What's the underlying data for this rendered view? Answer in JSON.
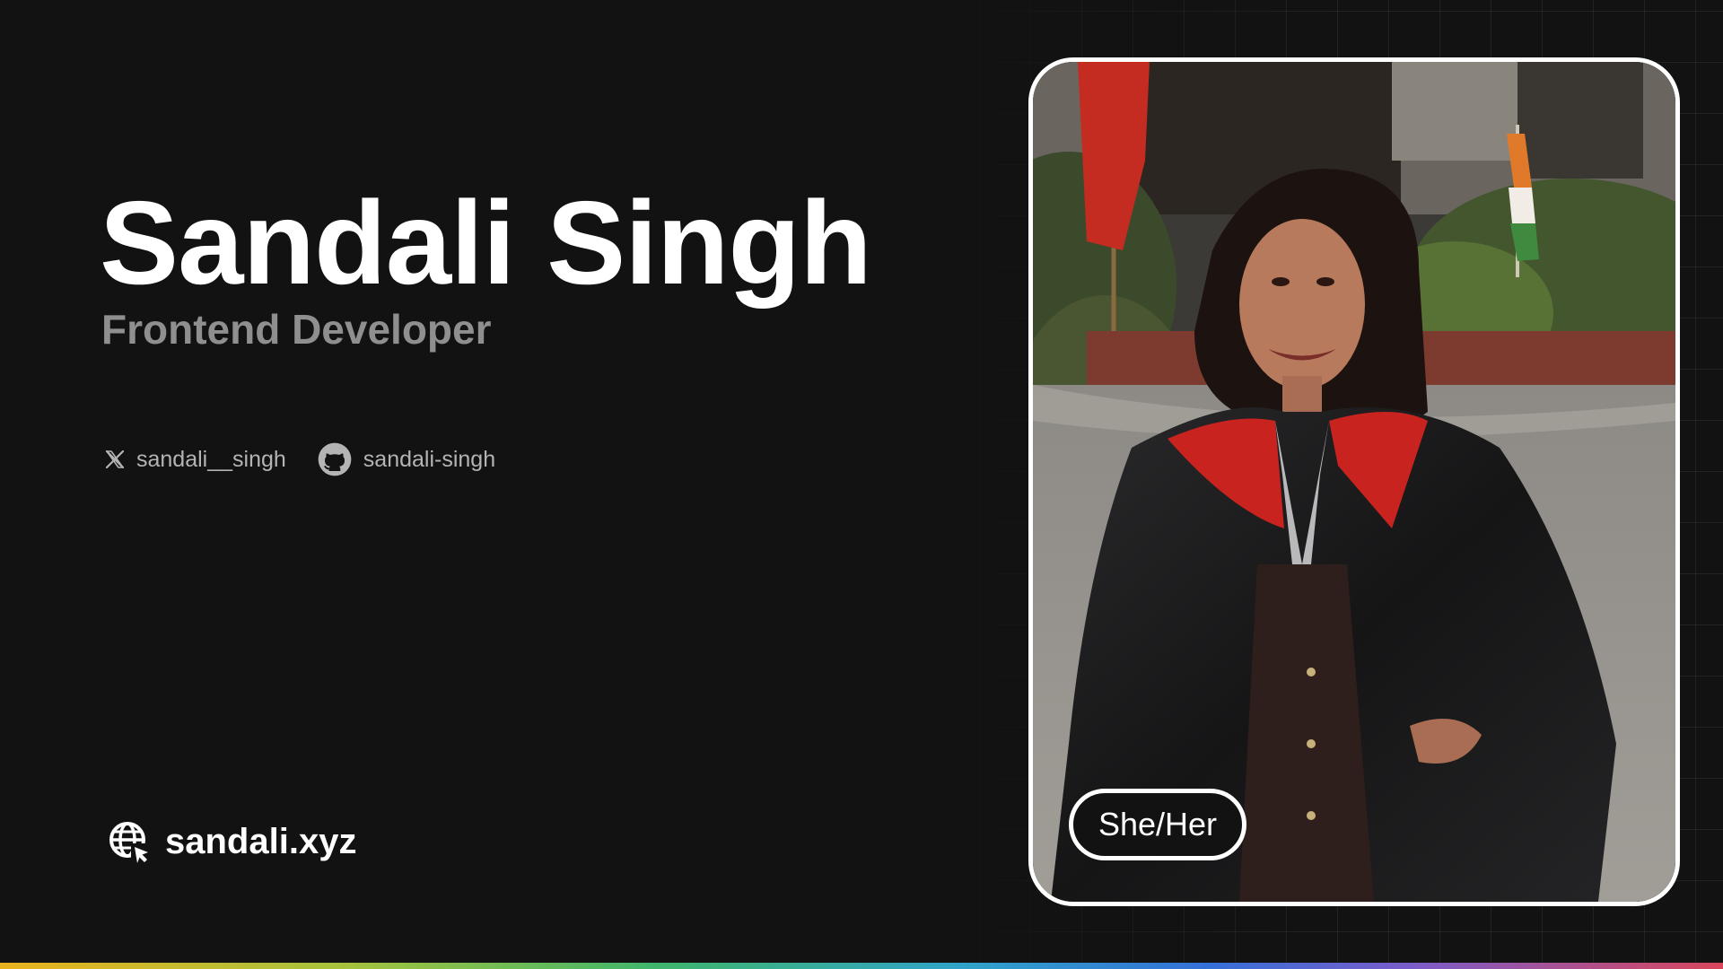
{
  "profile": {
    "name": "Sandali Singh",
    "role": "Frontend Developer",
    "pronouns": "She/Her"
  },
  "socials": [
    {
      "icon": "x-logo-icon",
      "handle": "sandali__singh"
    },
    {
      "icon": "github-icon",
      "handle": "sandali-singh"
    }
  ],
  "website": {
    "icon": "globe-cursor-icon",
    "label": "sandali.xyz"
  },
  "photo": {
    "description_icon": "profile-photo"
  },
  "colors": {
    "background": "#121212",
    "name": "#ffffff",
    "role": "#8f8f8f",
    "social_text": "#b4b4b4",
    "card_border": "#ffffff",
    "rainbow": [
      "#e8b21f",
      "#a6c23c",
      "#3fb56b",
      "#2fa3c9",
      "#3470d8",
      "#7b5cc9",
      "#d9465b"
    ]
  }
}
